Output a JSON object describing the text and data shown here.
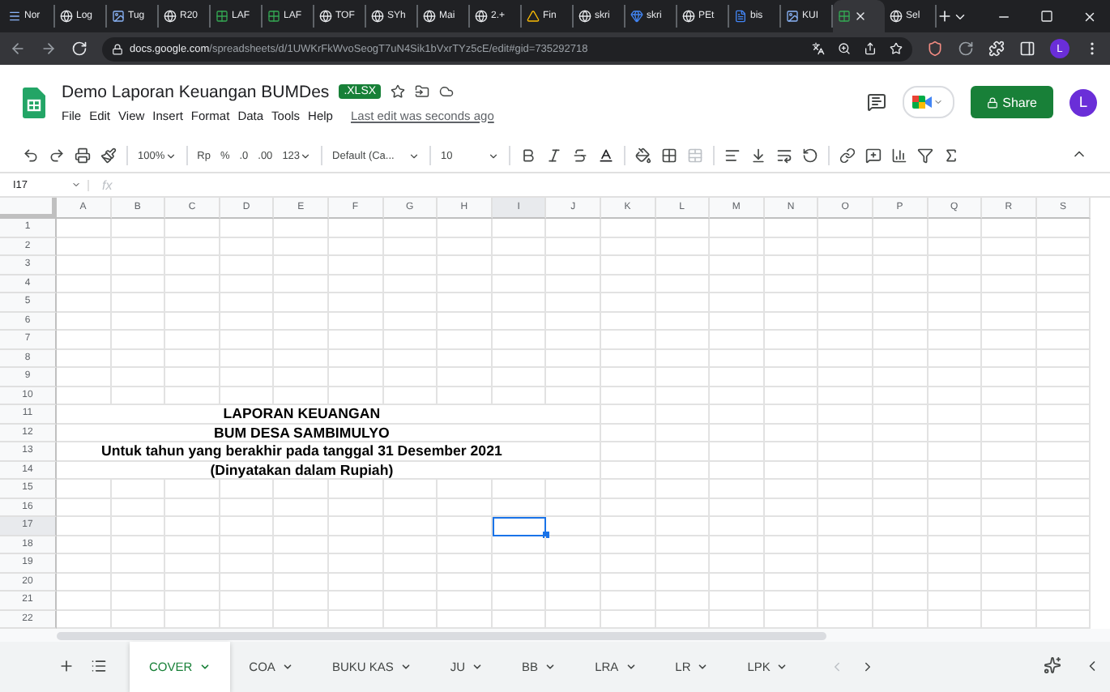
{
  "browser": {
    "tabs": [
      {
        "label": "Nor",
        "kind": "menu",
        "selected": false
      },
      {
        "label": "Log",
        "kind": "globe",
        "selected": false
      },
      {
        "label": "Tug",
        "kind": "image",
        "selected": false
      },
      {
        "label": "R20",
        "kind": "globe",
        "selected": false
      },
      {
        "label": "LAF",
        "kind": "sheets",
        "selected": false
      },
      {
        "label": "LAF",
        "kind": "sheets",
        "selected": false
      },
      {
        "label": "TOF",
        "kind": "globe",
        "selected": false
      },
      {
        "label": "SYh",
        "kind": "globe",
        "selected": false
      },
      {
        "label": "Mai",
        "kind": "globe",
        "selected": false
      },
      {
        "label": "2.+",
        "kind": "globe",
        "selected": false
      },
      {
        "label": "Fin",
        "kind": "drive",
        "selected": false
      },
      {
        "label": "skri",
        "kind": "globe",
        "selected": false
      },
      {
        "label": "skri",
        "kind": "gem",
        "selected": false
      },
      {
        "label": "PEt",
        "kind": "globe",
        "selected": false
      },
      {
        "label": "bis",
        "kind": "docs",
        "selected": false
      },
      {
        "label": "KUI",
        "kind": "image",
        "selected": false
      },
      {
        "kind": "sheets",
        "selected": true
      },
      {
        "label": "Sel",
        "kind": "globe",
        "selected": false
      }
    ],
    "url_domain": "docs.google.com",
    "url_path": "/spreadsheets/d/1UWKrFkWvoSeogT7uN4Sik1bVxrTYz5cE/edit#gid=735292718",
    "profile": "L"
  },
  "doc": {
    "title": "Demo Laporan Keuangan BUMDes",
    "badge": ".XLSX",
    "menus": [
      "File",
      "Edit",
      "View",
      "Insert",
      "Format",
      "Data",
      "Tools",
      "Help"
    ],
    "last_edit": "Last edit was seconds ago",
    "share": "Share",
    "avatar": "L"
  },
  "toolbar": {
    "zoom": "100%",
    "currency": "Rp",
    "percent": "%",
    "decrease_decimal": ".0",
    "increase_decimal": ".00",
    "number_format": "123",
    "font": "Default (Ca...",
    "font_size": "10"
  },
  "formula_bar": {
    "cell_ref": "I17",
    "fx": "fx"
  },
  "grid": {
    "columns": [
      {
        "label": "A",
        "selected": false
      },
      {
        "label": "B",
        "selected": false
      },
      {
        "label": "C",
        "selected": false
      },
      {
        "label": "D",
        "selected": false
      },
      {
        "label": "E",
        "selected": false
      },
      {
        "label": "F",
        "selected": false
      },
      {
        "label": "G",
        "selected": false
      },
      {
        "label": "H",
        "selected": false
      },
      {
        "label": "I",
        "selected": true
      },
      {
        "label": "J",
        "selected": false
      },
      {
        "label": "K",
        "selected": false
      },
      {
        "label": "L",
        "selected": false
      },
      {
        "label": "M",
        "selected": false
      },
      {
        "label": "N",
        "selected": false
      },
      {
        "label": "O",
        "selected": false
      },
      {
        "label": "P",
        "selected": false
      },
      {
        "label": "Q",
        "selected": false
      },
      {
        "label": "R",
        "selected": false
      },
      {
        "label": "S",
        "selected": false
      }
    ],
    "rows": [
      {
        "label": "1",
        "selected": false
      },
      {
        "label": "2",
        "selected": false
      },
      {
        "label": "3",
        "selected": false
      },
      {
        "label": "4",
        "selected": false
      },
      {
        "label": "5",
        "selected": false
      },
      {
        "label": "6",
        "selected": false
      },
      {
        "label": "7",
        "selected": false
      },
      {
        "label": "8",
        "selected": false
      },
      {
        "label": "9",
        "selected": false
      },
      {
        "label": "10",
        "selected": false
      },
      {
        "label": "11",
        "selected": false,
        "text": "LAPORAN KEUANGAN"
      },
      {
        "label": "12",
        "selected": false,
        "text": "BUM DESA SAMBIMULYO"
      },
      {
        "label": "13",
        "selected": false,
        "text": "Untuk tahun yang berakhir pada tanggal 31 Desember 2021"
      },
      {
        "label": "14",
        "selected": false,
        "text": "(Dinyatakan dalam Rupiah)"
      },
      {
        "label": "15",
        "selected": false
      },
      {
        "label": "16",
        "selected": false
      },
      {
        "label": "17",
        "selected": true
      },
      {
        "label": "18",
        "selected": false
      },
      {
        "label": "19",
        "selected": false
      },
      {
        "label": "20",
        "selected": false
      },
      {
        "label": "21",
        "selected": false
      },
      {
        "label": "22",
        "selected": false
      }
    ]
  },
  "sheet_tabs": [
    {
      "label": "COVER",
      "selected": true
    },
    {
      "label": "COA",
      "selected": false
    },
    {
      "label": "BUKU KAS",
      "selected": false
    },
    {
      "label": "JU",
      "selected": false
    },
    {
      "label": "BB",
      "selected": false
    },
    {
      "label": "LRA",
      "selected": false
    },
    {
      "label": "LR",
      "selected": false
    },
    {
      "label": "LPK",
      "selected": false
    }
  ]
}
